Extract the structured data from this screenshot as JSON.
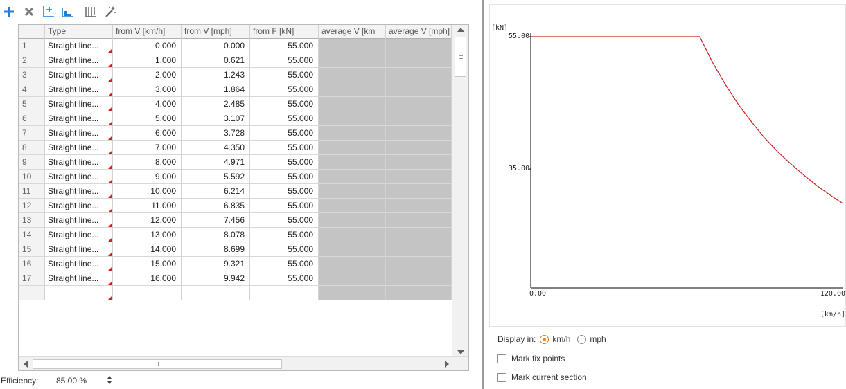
{
  "toolbar": {
    "buttons": [
      {
        "name": "add",
        "icon": "plus-icon",
        "color": "#1f7ed8"
      },
      {
        "name": "delete",
        "icon": "x-icon",
        "color": "#6b6b6b"
      },
      {
        "name": "add-curve",
        "icon": "curve-add-icon",
        "color": "#1f7ed8"
      },
      {
        "name": "step",
        "icon": "step-chart-icon",
        "color": "#1f7ed8"
      },
      {
        "name": "table",
        "icon": "columns-icon",
        "color": "#6b6b6b"
      },
      {
        "name": "wizard",
        "icon": "magic-wand-icon",
        "color": "#6b6b6b"
      }
    ]
  },
  "table": {
    "columns": [
      "Type",
      "from V [km/h]",
      "from V [mph]",
      "from F [kN]",
      "average V [km",
      "average V [mph]"
    ],
    "rows": [
      {
        "n": "1",
        "type": "Straight line...",
        "v_kmh": "0.000",
        "v_mph": "0.000",
        "f": "55.000"
      },
      {
        "n": "2",
        "type": "Straight line...",
        "v_kmh": "1.000",
        "v_mph": "0.621",
        "f": "55.000"
      },
      {
        "n": "3",
        "type": "Straight line...",
        "v_kmh": "2.000",
        "v_mph": "1.243",
        "f": "55.000"
      },
      {
        "n": "4",
        "type": "Straight line...",
        "v_kmh": "3.000",
        "v_mph": "1.864",
        "f": "55.000"
      },
      {
        "n": "5",
        "type": "Straight line...",
        "v_kmh": "4.000",
        "v_mph": "2.485",
        "f": "55.000"
      },
      {
        "n": "6",
        "type": "Straight line...",
        "v_kmh": "5.000",
        "v_mph": "3.107",
        "f": "55.000"
      },
      {
        "n": "7",
        "type": "Straight line...",
        "v_kmh": "6.000",
        "v_mph": "3.728",
        "f": "55.000"
      },
      {
        "n": "8",
        "type": "Straight line...",
        "v_kmh": "7.000",
        "v_mph": "4.350",
        "f": "55.000"
      },
      {
        "n": "9",
        "type": "Straight line...",
        "v_kmh": "8.000",
        "v_mph": "4.971",
        "f": "55.000"
      },
      {
        "n": "10",
        "type": "Straight line...",
        "v_kmh": "9.000",
        "v_mph": "5.592",
        "f": "55.000"
      },
      {
        "n": "11",
        "type": "Straight line...",
        "v_kmh": "10.000",
        "v_mph": "6.214",
        "f": "55.000"
      },
      {
        "n": "12",
        "type": "Straight line...",
        "v_kmh": "11.000",
        "v_mph": "6.835",
        "f": "55.000"
      },
      {
        "n": "13",
        "type": "Straight line...",
        "v_kmh": "12.000",
        "v_mph": "7.456",
        "f": "55.000"
      },
      {
        "n": "14",
        "type": "Straight line...",
        "v_kmh": "13.000",
        "v_mph": "8.078",
        "f": "55.000"
      },
      {
        "n": "15",
        "type": "Straight line...",
        "v_kmh": "14.000",
        "v_mph": "8.699",
        "f": "55.000"
      },
      {
        "n": "16",
        "type": "Straight line...",
        "v_kmh": "15.000",
        "v_mph": "9.321",
        "f": "55.000"
      },
      {
        "n": "17",
        "type": "Straight line...",
        "v_kmh": "16.000",
        "v_mph": "9.942",
        "f": "55.000"
      }
    ]
  },
  "efficiency": {
    "label": "Efficiency:",
    "value": "85.00 %"
  },
  "chart_data": {
    "type": "line",
    "title": "",
    "ylabel": "[kN]",
    "xlabel": "[km/h]",
    "xlim": [
      0,
      120
    ],
    "ylim": [
      17,
      55
    ],
    "ytick_labels": [
      "55.00",
      "35.00"
    ],
    "xtick_labels": [
      "0.00",
      "120.00"
    ],
    "grid": false,
    "color": "#cc1f1f",
    "x": [
      0,
      65,
      70,
      75,
      80,
      85,
      90,
      95,
      100,
      105,
      110,
      115,
      120
    ],
    "y": [
      55,
      55,
      51.1,
      47.7,
      44.7,
      42.1,
      39.7,
      37.6,
      35.8,
      34.1,
      32.5,
      31.1,
      29.8
    ]
  },
  "options": {
    "display_label": "Display in:",
    "unit_kmh": "km/h",
    "unit_mph": "mph",
    "selected_unit": "km/h",
    "mark_fix_points": "Mark fix points",
    "mark_current_section": "Mark current section"
  }
}
